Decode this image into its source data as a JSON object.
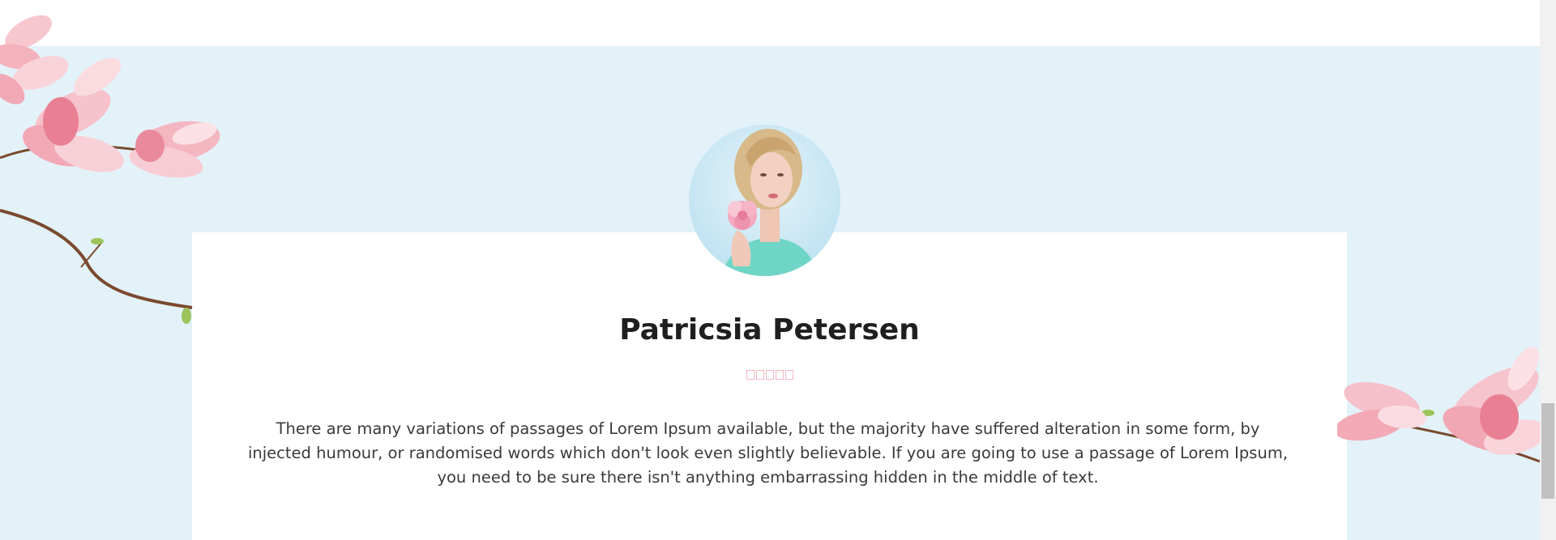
{
  "testimonial": {
    "name": "Patricsia Petersen",
    "rating": 5,
    "quote": "There are many variations of passages of Lorem Ipsum available, but the majority have suffered alteration in some form, by injected humour, or randomised words which don't look even slightly believable. If you are going to use a passage of Lorem Ipsum, you need to be sure there isn't anything embarrassing hidden in the middle of text."
  },
  "colors": {
    "section_background": "#e3f2f8",
    "card_background": "#ffffff",
    "star_outline": "#f2b7c0",
    "name_text": "#1f1f1f",
    "body_text": "#3a3a3a"
  },
  "icons": {
    "star": "star-outline-icon"
  }
}
